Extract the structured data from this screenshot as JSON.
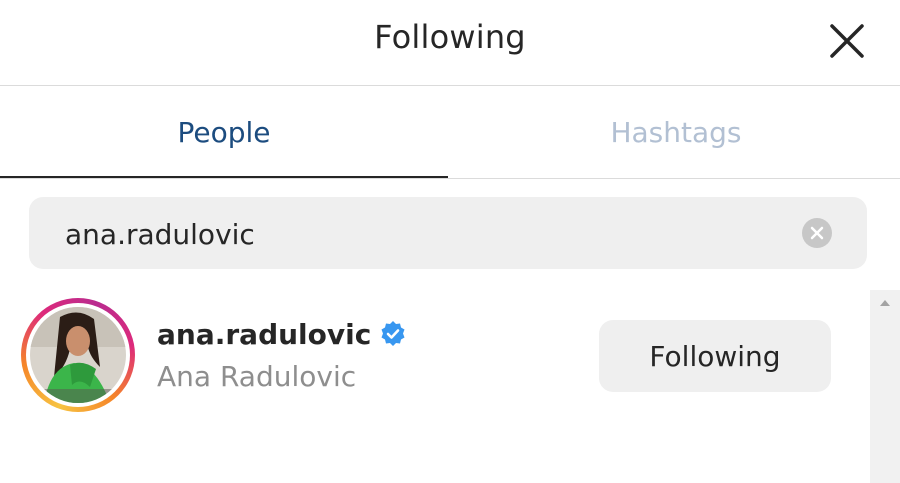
{
  "header": {
    "title": "Following",
    "close_icon": "close-icon"
  },
  "tabs": [
    {
      "label": "People",
      "active": true
    },
    {
      "label": "Hashtags",
      "active": false
    }
  ],
  "search": {
    "value": "ana.radulovic",
    "clear_icon": "clear-circle-icon"
  },
  "results": [
    {
      "username": "ana.radulovic",
      "verified": true,
      "full_name": "Ana Radulovic",
      "action_label": "Following"
    }
  ],
  "colors": {
    "active_tab": "#1c4c7f",
    "inactive_tab": "#b2c0d3",
    "verified_badge": "#3897f0",
    "secondary_text": "#8e8e8e",
    "button_bg": "#efefef"
  }
}
